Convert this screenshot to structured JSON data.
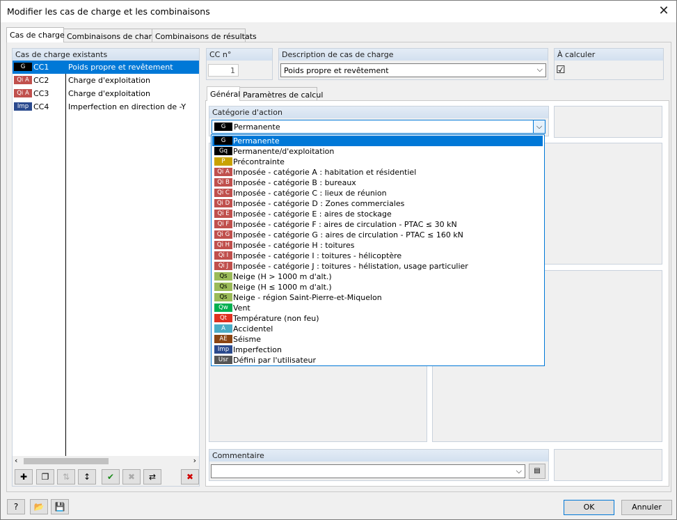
{
  "window": {
    "title": "Modifier les cas de charge et les combinaisons"
  },
  "tabs": [
    "Cas de charge",
    "Combinaisons de charge",
    "Combinaisons de résultats"
  ],
  "left": {
    "header": "Cas de charge existants",
    "rows": [
      {
        "badge": "G",
        "badge_color": "#000000",
        "id": "CC1",
        "desc": "Poids propre et revêtement"
      },
      {
        "badge": "Qi A",
        "badge_color": "#c0504d",
        "id": "CC2",
        "desc": "Charge d'exploitation"
      },
      {
        "badge": "Qi A",
        "badge_color": "#c0504d",
        "id": "CC3",
        "desc": "Charge d'exploitation"
      },
      {
        "badge": "Imp",
        "badge_color": "#2b4a8e",
        "id": "CC4",
        "desc": "Imperfection en direction de -Y"
      }
    ]
  },
  "cc_no": {
    "header": "CC n°",
    "value": "1"
  },
  "description": {
    "header": "Description de cas de charge",
    "value": "Poids propre et revêtement"
  },
  "calculate": {
    "header": "À calculer",
    "check": "☑"
  },
  "subtabs": [
    "Général",
    "Paramètres de calcul"
  ],
  "category": {
    "header": "Catégorie d'action",
    "selected_badge": "G",
    "selected_label": "Permanente"
  },
  "dropdown": [
    {
      "badge": "G",
      "color": "#000000",
      "label": "Permanente"
    },
    {
      "badge": "Gq",
      "color": "#000000",
      "label": "Permanente/d'exploitation"
    },
    {
      "badge": "P",
      "color": "#c9a200",
      "label": "Précontrainte"
    },
    {
      "badge": "Qi A",
      "color": "#c0504d",
      "label": "Imposée - catégorie A : habitation et résidentiel"
    },
    {
      "badge": "Qi B",
      "color": "#c0504d",
      "label": "Imposée - catégorie B : bureaux"
    },
    {
      "badge": "Qi C",
      "color": "#c0504d",
      "label": "Imposée - catégorie C : lieux de réunion"
    },
    {
      "badge": "Qi D",
      "color": "#c0504d",
      "label": "Imposée - catégorie D : Zones commerciales"
    },
    {
      "badge": "Qi E",
      "color": "#c0504d",
      "label": "Imposée - catégorie E : aires de stockage"
    },
    {
      "badge": "Qi F",
      "color": "#c0504d",
      "label": "Imposée - catégorie F : aires de circulation - PTAC ≤ 30 kN"
    },
    {
      "badge": "Qi G",
      "color": "#c0504d",
      "label": "Imposée - catégorie G : aires de circulation - PTAC ≤ 160 kN"
    },
    {
      "badge": "Qi H",
      "color": "#c0504d",
      "label": "Imposée - catégorie H : toitures"
    },
    {
      "badge": "Qi I",
      "color": "#c0504d",
      "label": "Imposée - catégorie I : toitures - hélicoptère"
    },
    {
      "badge": "Qi J",
      "color": "#c0504d",
      "label": "Imposée - catégorie J : toitures - hélistation, usage particulier"
    },
    {
      "badge": "Qs",
      "color": "#9bbb59",
      "label": "Neige (H > 1000 m d'alt.)"
    },
    {
      "badge": "Qs",
      "color": "#9bbb59",
      "label": "Neige (H ≤ 1000 m d'alt.)"
    },
    {
      "badge": "Qs",
      "color": "#9bbb59",
      "label": "Neige - région Saint-Pierre-et-Miquelon"
    },
    {
      "badge": "Qw",
      "color": "#00b050",
      "label": "Vent"
    },
    {
      "badge": "Qt",
      "color": "#e03020",
      "label": "Température (non feu)"
    },
    {
      "badge": "A",
      "color": "#4bacc6",
      "label": "Accidentel"
    },
    {
      "badge": "AE",
      "color": "#8b4513",
      "label": "Séisme"
    },
    {
      "badge": "Imp",
      "color": "#2b4a8e",
      "label": "Imperfection"
    },
    {
      "badge": "Usr",
      "color": "#555555",
      "label": "Défini par l'utilisateur"
    }
  ],
  "comment": {
    "header": "Commentaire",
    "value": ""
  },
  "buttons": {
    "ok": "OK",
    "cancel": "Annuler"
  }
}
